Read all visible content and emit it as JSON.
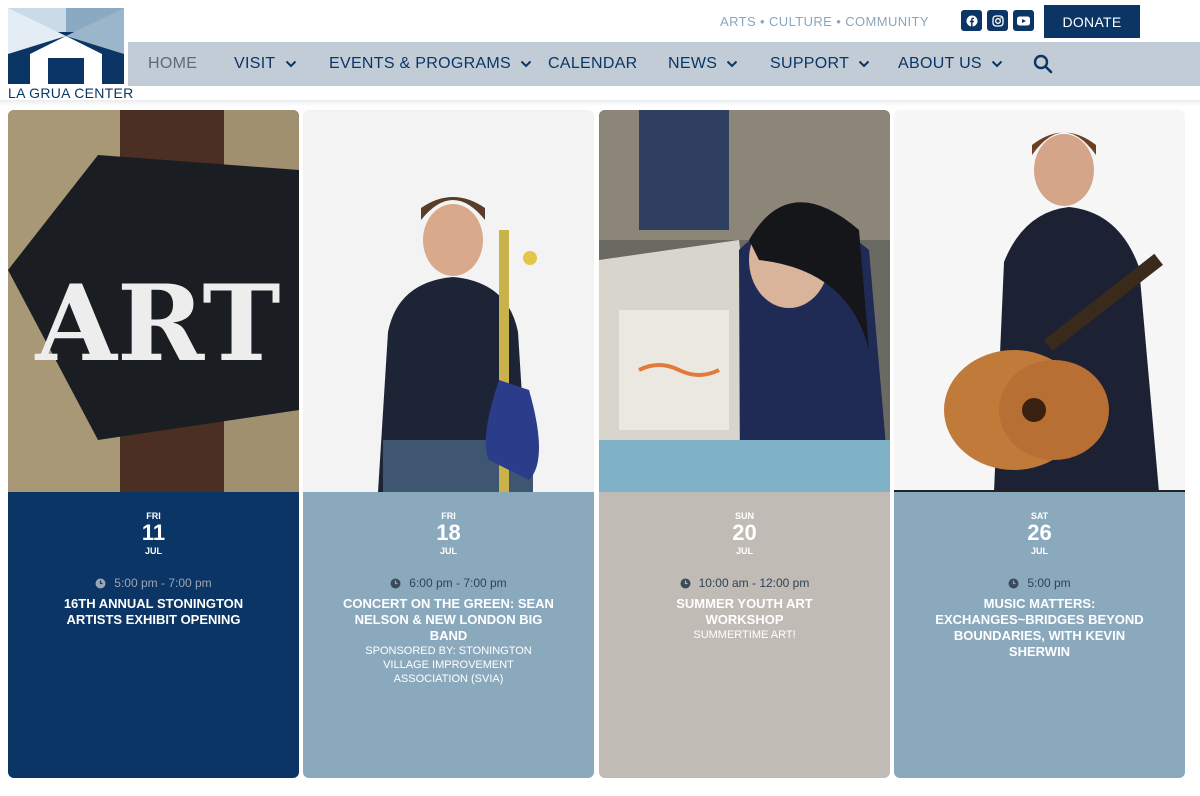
{
  "brand": {
    "logo_text": "LA GRUA CENTER",
    "tagline": "ARTS • CULTURE • COMMUNITY",
    "colors": {
      "navy": "#0b3564",
      "steel": "#8ba9bd",
      "stone": "#c1bbb5",
      "nav_bg": "#c2ccd6"
    }
  },
  "social": [
    "facebook-icon",
    "instagram-icon",
    "youtube-icon"
  ],
  "donate_label": "DONATE",
  "nav": {
    "items": [
      {
        "label": "HOME",
        "dropdown": false,
        "active": true
      },
      {
        "label": "VISIT",
        "dropdown": true
      },
      {
        "label": "EVENTS & PROGRAMS",
        "dropdown": true
      },
      {
        "label": "CALENDAR",
        "dropdown": false
      },
      {
        "label": "NEWS",
        "dropdown": true
      },
      {
        "label": "SUPPORT",
        "dropdown": true
      },
      {
        "label": "ABOUT US",
        "dropdown": true
      }
    ],
    "search_icon": "search-icon"
  },
  "events": [
    {
      "dow": "FRI",
      "day": "11",
      "month": "JUL",
      "time": "5:00 pm - 7:00 pm",
      "title": "16TH ANNUAL STONINGTON ARTISTS EXHIBIT OPENING",
      "subtitle": "",
      "color": "#0b3564",
      "image": "art-sign-photo"
    },
    {
      "dow": "FRI",
      "day": "18",
      "month": "JUL",
      "time": "6:00 pm - 7:00 pm",
      "title": "CONCERT ON THE GREEN: SEAN NELSON & NEW LONDON BIG BAND",
      "subtitle": "SPONSORED BY: STONINGTON VILLAGE IMPROVEMENT ASSOCIATION (SVIA)",
      "color": "#8ba9bd",
      "image": "trombone-player-photo"
    },
    {
      "dow": "SUN",
      "day": "20",
      "month": "JUL",
      "time": "10:00 am - 12:00 pm",
      "title": "SUMMER YOUTH ART WORKSHOP",
      "subtitle": "SUMMERTIME ART!",
      "color": "#c1bbb5",
      "image": "youth-art-workshop-photo"
    },
    {
      "dow": "SAT",
      "day": "26",
      "month": "JUL",
      "time": "5:00 pm",
      "title": "MUSIC MATTERS: EXCHANGES~BRIDGES BEYOND BOUNDARIES, WITH KEVIN SHERWIN",
      "subtitle": "",
      "color": "#8ba9bd",
      "image": "guitarist-photo"
    }
  ]
}
